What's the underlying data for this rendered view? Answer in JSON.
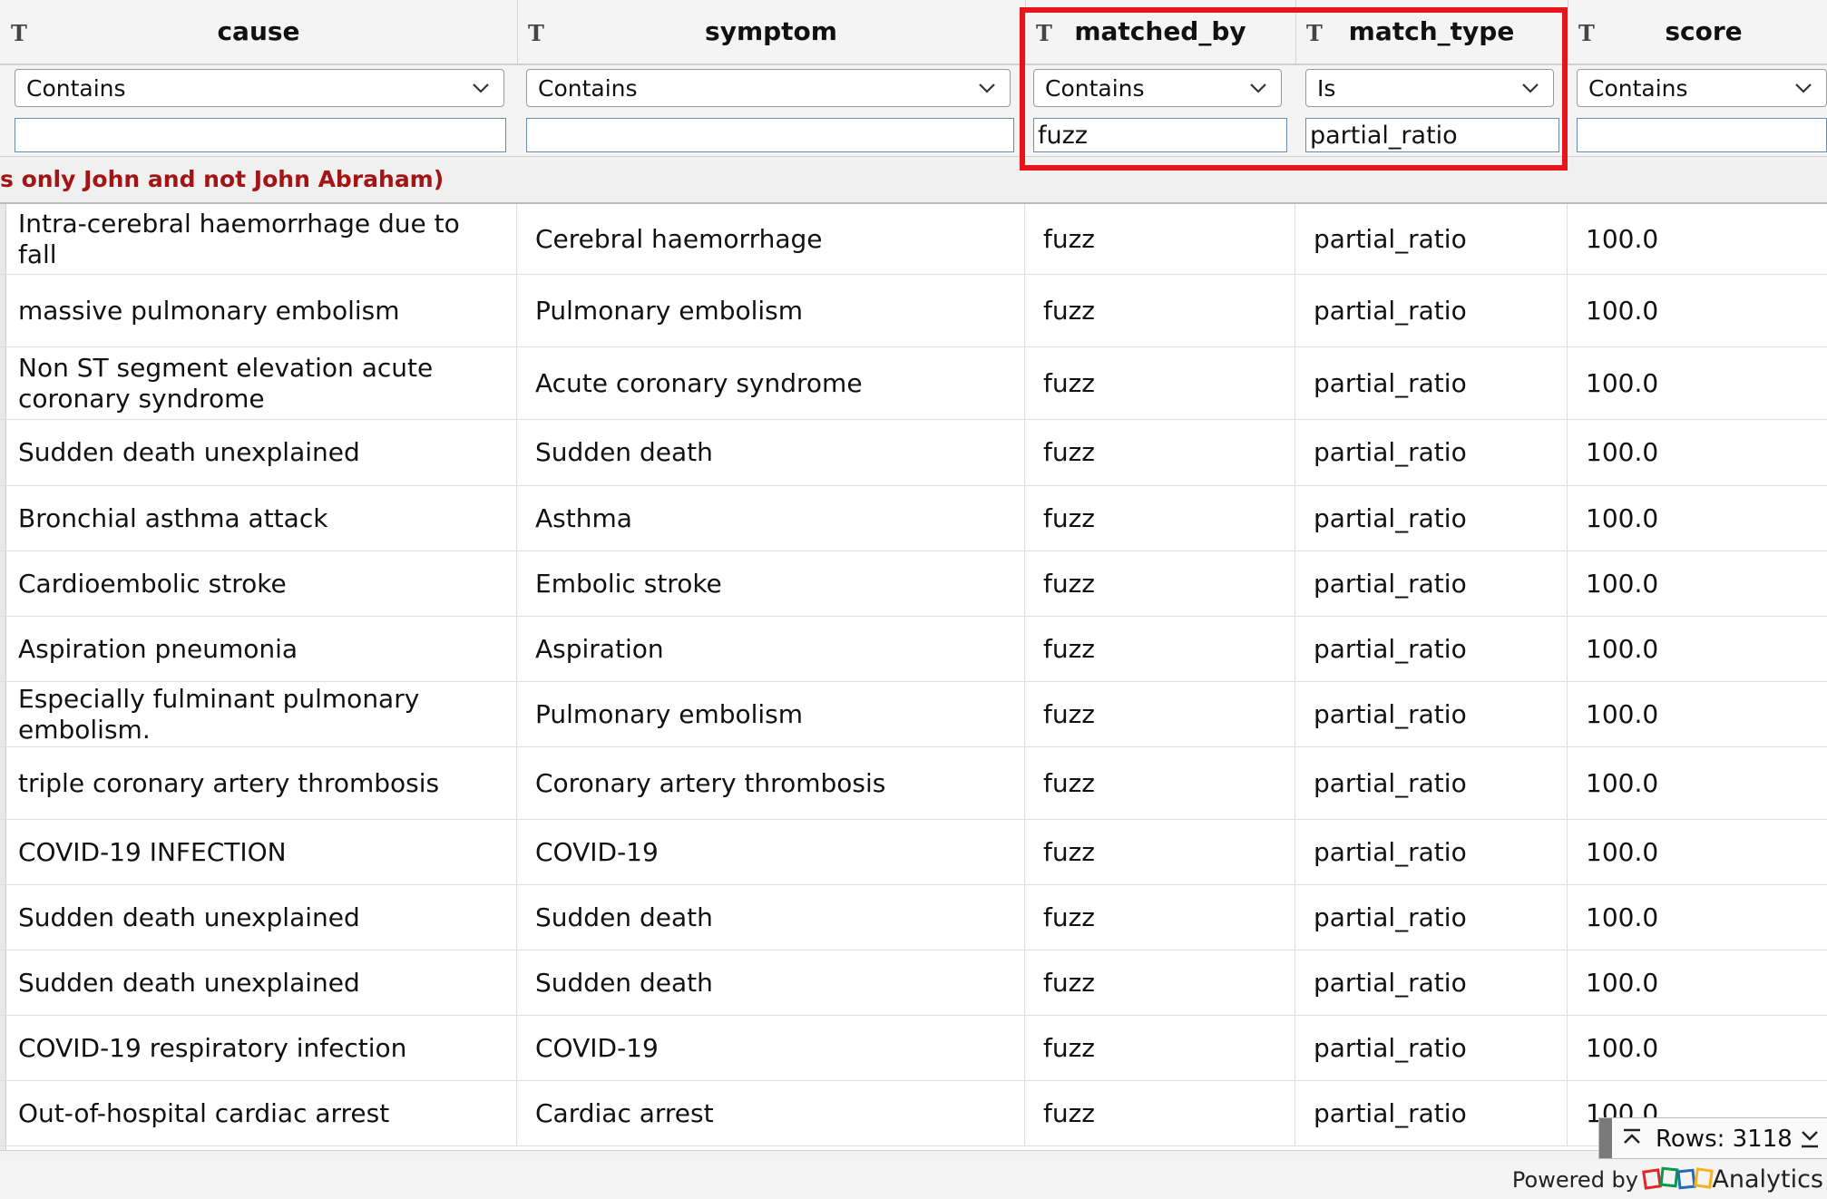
{
  "columns": [
    {
      "key": "cause",
      "title": "cause",
      "type_icon": "T",
      "operator": "Contains",
      "filter_value": ""
    },
    {
      "key": "symptom",
      "title": "symptom",
      "type_icon": "T",
      "operator": "Contains",
      "filter_value": ""
    },
    {
      "key": "matched_by",
      "title": "matched_by",
      "type_icon": "T",
      "operator": "Contains",
      "filter_value": "fuzz"
    },
    {
      "key": "match_type",
      "title": "match_type",
      "type_icon": "T",
      "operator": "Is",
      "filter_value": "partial_ratio"
    },
    {
      "key": "score",
      "title": "score",
      "type_icon": "T",
      "operator": "Contains",
      "filter_value": ""
    }
  ],
  "notice": "s only John and not John Abraham)",
  "rows": [
    {
      "cause": "Intra-cerebral haemorrhage due to fall",
      "symptom": "Cerebral haemorrhage",
      "matched_by": "fuzz",
      "match_type": "partial_ratio",
      "score": "100.0"
    },
    {
      "cause": "massive pulmonary embolism",
      "symptom": "Pulmonary embolism",
      "matched_by": "fuzz",
      "match_type": "partial_ratio",
      "score": "100.0"
    },
    {
      "cause": "Non ST segment elevation acute coronary syndrome",
      "symptom": "Acute coronary syndrome",
      "matched_by": "fuzz",
      "match_type": "partial_ratio",
      "score": "100.0"
    },
    {
      "cause": "Sudden death unexplained",
      "symptom": "Sudden death",
      "matched_by": "fuzz",
      "match_type": "partial_ratio",
      "score": "100.0"
    },
    {
      "cause": "Bronchial asthma attack",
      "symptom": "Asthma",
      "matched_by": "fuzz",
      "match_type": "partial_ratio",
      "score": "100.0"
    },
    {
      "cause": "Cardioembolic stroke",
      "symptom": "Embolic stroke",
      "matched_by": "fuzz",
      "match_type": "partial_ratio",
      "score": "100.0"
    },
    {
      "cause": "Aspiration pneumonia",
      "symptom": "Aspiration",
      "matched_by": "fuzz",
      "match_type": "partial_ratio",
      "score": "100.0"
    },
    {
      "cause": "Especially fulminant pulmonary embolism.",
      "symptom": "Pulmonary embolism",
      "matched_by": "fuzz",
      "match_type": "partial_ratio",
      "score": "100.0"
    },
    {
      "cause": "triple coronary artery thrombosis",
      "symptom": "Coronary artery thrombosis",
      "matched_by": "fuzz",
      "match_type": "partial_ratio",
      "score": "100.0"
    },
    {
      "cause": "COVID-19 INFECTION",
      "symptom": "COVID-19",
      "matched_by": "fuzz",
      "match_type": "partial_ratio",
      "score": "100.0"
    },
    {
      "cause": "Sudden death unexplained",
      "symptom": "Sudden death",
      "matched_by": "fuzz",
      "match_type": "partial_ratio",
      "score": "100.0"
    },
    {
      "cause": "Sudden death unexplained",
      "symptom": "Sudden death",
      "matched_by": "fuzz",
      "match_type": "partial_ratio",
      "score": "100.0"
    },
    {
      "cause": "COVID-19 respiratory infection",
      "symptom": "COVID-19",
      "matched_by": "fuzz",
      "match_type": "partial_ratio",
      "score": "100.0"
    },
    {
      "cause": "Out-of-hospital cardiac arrest",
      "symptom": "Cardiac arrest",
      "matched_by": "fuzz",
      "match_type": "partial_ratio",
      "score": "100.0"
    }
  ],
  "footer": {
    "rows_label": "Rows: 3118",
    "powered_by": "Powered by",
    "brand": "Analytics",
    "logo_icon": "zoho-logo-icon"
  },
  "colors": {
    "highlight": "#e8141b",
    "notice_text": "#a31515"
  }
}
